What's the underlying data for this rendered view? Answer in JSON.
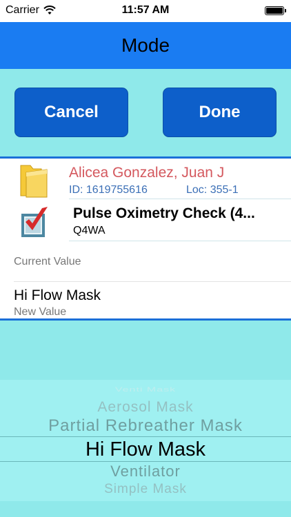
{
  "status_bar": {
    "carrier": "Carrier",
    "time": "11:57 AM"
  },
  "nav": {
    "title": "Mode"
  },
  "buttons": {
    "cancel": "Cancel",
    "done": "Done"
  },
  "patient": {
    "name": "Alicea Gonzalez, Juan J",
    "id": "ID: 1619755616",
    "loc": "Loc: 355-1"
  },
  "task": {
    "title": "Pulse Oximetry Check (4...",
    "frequency": "Q4WA"
  },
  "current_value": {
    "label": "Current Value"
  },
  "new_value": {
    "value": "Hi Flow Mask",
    "label": "New Value"
  },
  "picker": {
    "items": [
      "Venti Mask",
      "Aerosol Mask",
      "Partial Rebreather Mask",
      "Hi Flow Mask",
      "Ventilator",
      "Simple Mask"
    ],
    "selected": "Hi Flow Mask"
  },
  "colors": {
    "nav_bg": "#1a7cf2",
    "button_bg": "#0d5fca",
    "page_bg": "#8fe9ea",
    "patient_name": "#d4585e",
    "patient_meta": "#3b6fb6"
  },
  "icons": {
    "patient": "folder-icon",
    "task": "checkbox-icon",
    "wifi": "wifi-icon",
    "battery": "battery-icon"
  }
}
